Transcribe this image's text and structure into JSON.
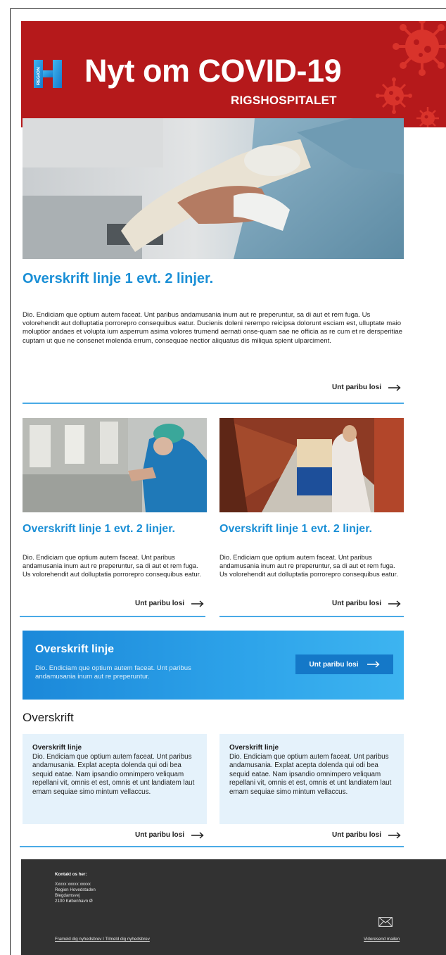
{
  "header": {
    "title": "Nyt om COVID-19",
    "subtitle": "RIGSHOSPITALET",
    "logo_text": "REGION",
    "background": "#b5191b"
  },
  "hero": {
    "title": "Overskrift linje 1 evt. 2 linjer.",
    "body": "Dio. Endiciam que optium autem faceat. Unt paribus andamusania inum aut re preperuntur, sa di aut et rem fuga. Us volorehendit aut dolluptatia porrorepro consequibus eatur. Ducienis doleni rerempo reicipsa dolorunt esciam est, ulluptate maio moluptior andaes et volupta ium asperrum asima volores trumend aernati onse-quam sae ne officia as re cum et re dersperitiae cuptam ut que ne consenet molenda errum, consequae nectior aliquatus dis miliqua spient ulparciment.",
    "link": "Unt paribu losi"
  },
  "columns": [
    {
      "title": "Overskrift linje 1 evt. 2 linjer.",
      "body": "Dio. Endiciam que optium autem faceat. Unt paribus andamusania inum aut re preperuntur, sa di aut et rem fuga. Us volorehendit aut dolluptatia porrorepro consequibus eatur.",
      "link": "Unt paribu losi"
    },
    {
      "title": "Overskrift linje 1 evt. 2 linjer.",
      "body": "Dio. Endiciam que optium autem faceat. Unt paribus andamusania inum aut re preperuntur, sa di aut et rem fuga. Us volorehendit aut dolluptatia porrorepro consequibus eatur.",
      "link": "Unt paribu losi"
    }
  ],
  "banner": {
    "title": "Overskrift linje",
    "body": "Dio. Endiciam que optium autem faceat. Unt paribus andamusania inum aut re preperuntur.",
    "button": "Unt paribu losi"
  },
  "section": {
    "heading": "Overskrift",
    "boxes": [
      {
        "title": "Overskrift linje",
        "body": "Dio. Endiciam que optium autem faceat. Unt paribus andamusania. Explat acepta dolenda qui odi bea sequid eatae. Nam ipsandio omnimpero veliquam repellani vit, omnis et est, omnis et unt landiatem laut emam sequiae simo mintum vellaccus.",
        "link": "Unt paribu losi"
      },
      {
        "title": "Overskrift linje",
        "body": "Dio. Endiciam que optium autem faceat. Unt paribus andamusania. Explat acepta dolenda qui odi bea sequid eatae. Nam ipsandio omnimpero veliquam repellani vit, omnis et est, omnis et unt landiatem laut emam sequiae simo mintum vellaccus.",
        "link": "Unt paribu losi"
      }
    ]
  },
  "footer": {
    "heading": "Kontakt os her:",
    "lines": [
      "Xxxxx xxxxx xxxxx",
      "Region Hovedstaden",
      "Blegdamsvej",
      "2100 København Ø"
    ],
    "links": "Frameld dig nyhedsbrev I Tilmeld dig nyhedsbrev",
    "forward": "Videresend mailen",
    "mail_icon": "envelope-icon"
  },
  "colors": {
    "accent": "#1a8fd6",
    "banner_start": "#1b88d9",
    "box_bg": "#e5f2fb",
    "footer_bg": "#323232"
  }
}
